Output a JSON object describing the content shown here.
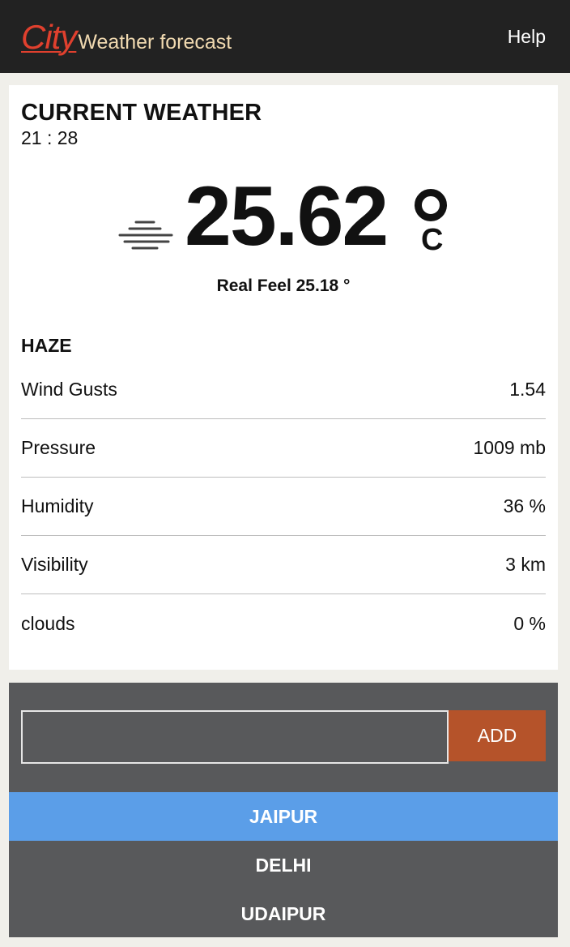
{
  "navbar": {
    "brand_name": "City",
    "brand_subtitle": "Weather forecast",
    "help_label": "Help"
  },
  "current": {
    "title": "CURRENT WEATHER",
    "time": "21 : 28",
    "icon": "haze-icon",
    "temperature": "25.62",
    "unit": "C",
    "real_feel": "Real Feel 25.18 °",
    "condition": "HAZE",
    "details": [
      {
        "label": "Wind Gusts",
        "value": "1.54"
      },
      {
        "label": "Pressure",
        "value": "1009 mb"
      },
      {
        "label": "Humidity",
        "value": "36 %"
      },
      {
        "label": "Visibility",
        "value": "3 km"
      },
      {
        "label": "clouds",
        "value": "0 %"
      }
    ]
  },
  "cities": {
    "input_value": "",
    "add_label": "ADD",
    "items": [
      {
        "label": "JAIPUR",
        "active": true
      },
      {
        "label": "DELHI",
        "active": false
      },
      {
        "label": "UDAIPUR",
        "active": false
      }
    ]
  },
  "colors": {
    "navbar_bg": "#222222",
    "brand": "#e0402e",
    "subtitle": "#f0d9b0",
    "add_button": "#b5532a",
    "active_city": "#5b9ee8",
    "panel_bg": "#58595b"
  }
}
